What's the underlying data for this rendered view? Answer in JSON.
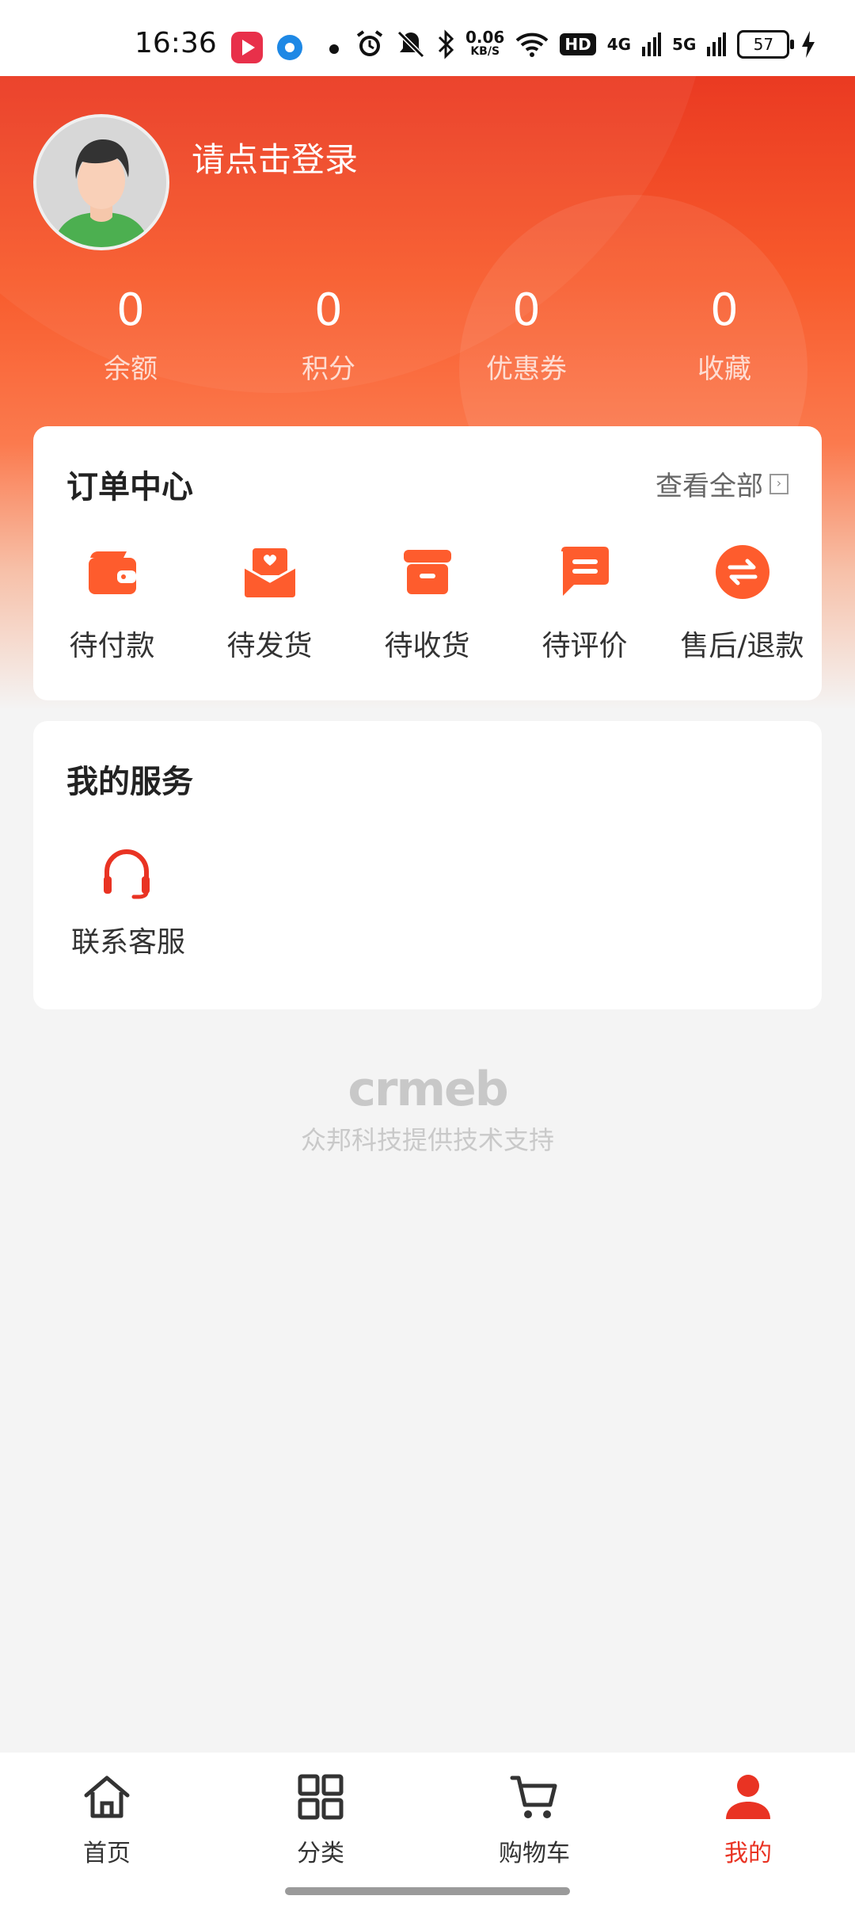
{
  "status_bar": {
    "time": "16:36",
    "network_speed_value": "0.06",
    "network_speed_unit": "KB/S",
    "hd_badge": "HD",
    "sig1": "4G",
    "sig2": "5G",
    "battery": "57"
  },
  "profile": {
    "login_prompt": "请点击登录"
  },
  "stats": [
    {
      "value": "0",
      "label": "余额"
    },
    {
      "value": "0",
      "label": "积分"
    },
    {
      "value": "0",
      "label": "优惠券"
    },
    {
      "value": "0",
      "label": "收藏"
    }
  ],
  "order_center": {
    "title": "订单中心",
    "view_all": "查看全部",
    "items": [
      {
        "label": "待付款",
        "icon": "wallet-icon"
      },
      {
        "label": "待发货",
        "icon": "package-heart-icon"
      },
      {
        "label": "待收货",
        "icon": "box-icon"
      },
      {
        "label": "待评价",
        "icon": "comment-icon"
      },
      {
        "label": "售后/退款",
        "icon": "exchange-icon"
      }
    ]
  },
  "services": {
    "title": "我的服务",
    "items": [
      {
        "label": "联系客服",
        "icon": "headset-icon"
      }
    ]
  },
  "footer": {
    "logo": "crmeb",
    "support": "众邦科技提供技术支持"
  },
  "tabbar": {
    "items": [
      {
        "label": "首页",
        "icon": "home-icon"
      },
      {
        "label": "分类",
        "icon": "grid-icon"
      },
      {
        "label": "购物车",
        "icon": "cart-icon"
      },
      {
        "label": "我的",
        "icon": "user-icon"
      }
    ],
    "active": "我的"
  },
  "colors": {
    "accent": "#e93323",
    "icon_orange": "#fe5c2d",
    "background": "#f4f4f4"
  }
}
